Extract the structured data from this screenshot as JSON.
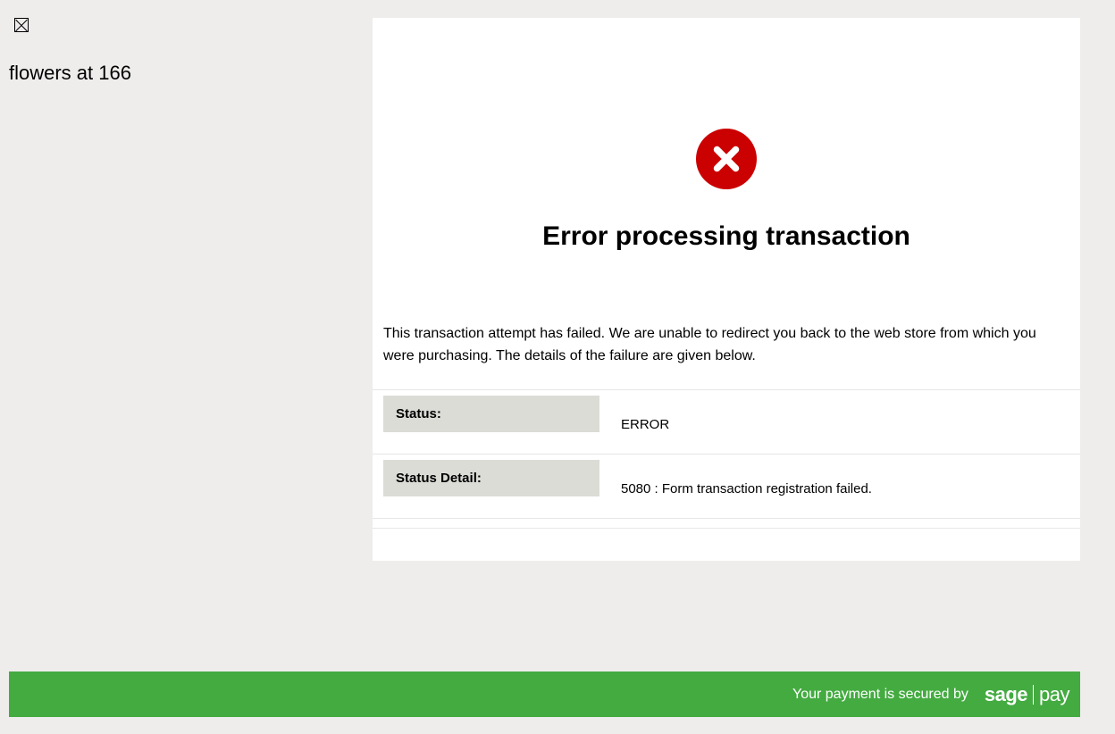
{
  "site": {
    "name": "flowers at 166"
  },
  "error": {
    "title": "Error processing transaction",
    "description": "This transaction attempt has failed. We are unable to redirect you back to the web store from which you were purchasing. The details of the failure are given below."
  },
  "details": [
    {
      "label": "Status:",
      "value": "ERROR"
    },
    {
      "label": "Status Detail:",
      "value": "5080 : Form transaction registration failed."
    }
  ],
  "footer": {
    "secured_text": "Your payment is secured by",
    "logo_sage": "sage",
    "logo_pay": "pay"
  }
}
